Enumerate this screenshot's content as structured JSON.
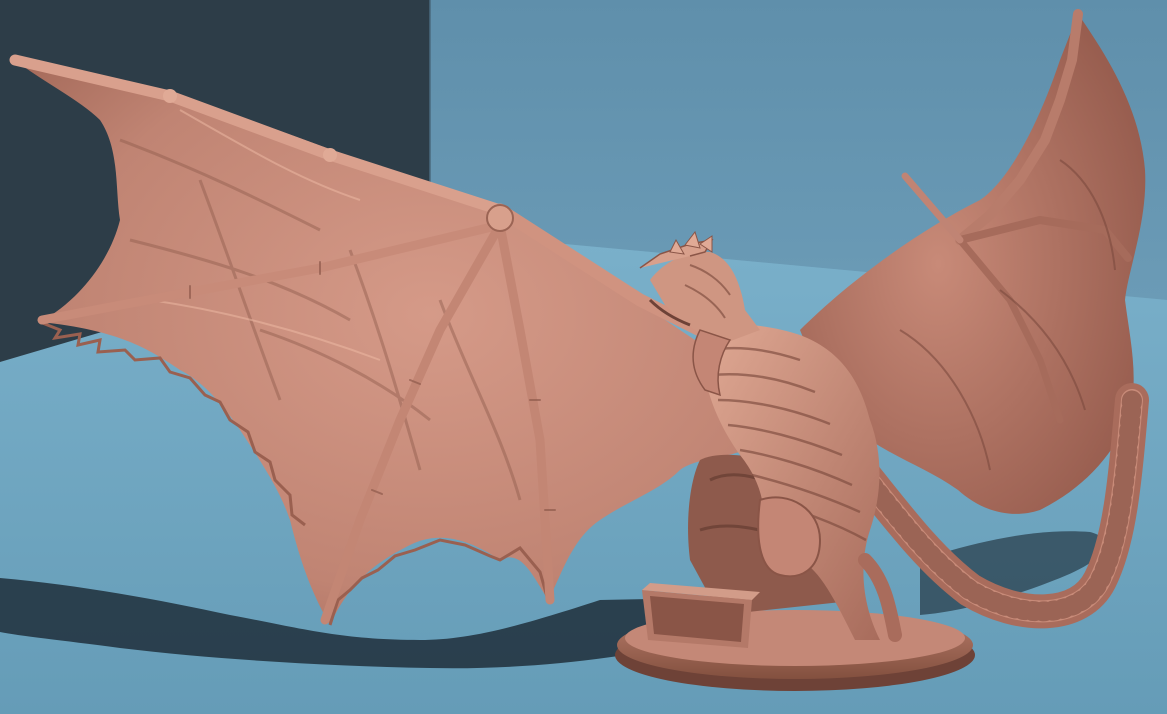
{
  "scene": {
    "subject": "dragon-miniature-sculpt",
    "colors": {
      "back_wall_left": "#2d3d48",
      "back_wall_right": "#6594b0",
      "floor": "#6fa3bd",
      "floor_far": "#75a9c3",
      "shadow": "#1f2f3a",
      "clay": "#c98d7c",
      "clay_light": "#e3ab98",
      "clay_dark": "#8e5a4c",
      "clay_deep": "#6e4237"
    }
  }
}
